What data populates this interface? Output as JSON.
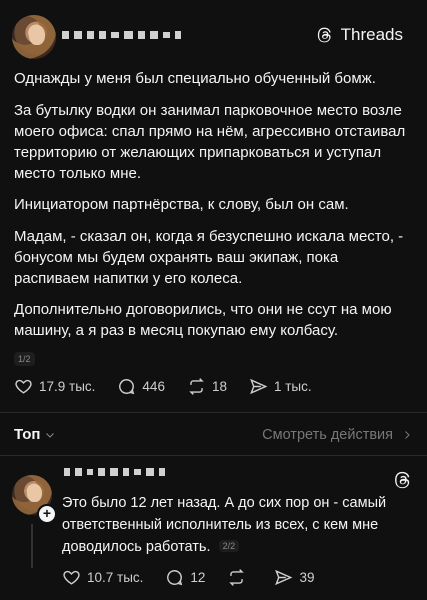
{
  "brand": {
    "name": "Threads"
  },
  "post": {
    "paragraphs": [
      "Однажды у меня был специально обученный бомж.",
      "За бутылку водки он занимал парковочное место возле моего офиса: спал прямо на нём, агрессивно отстаивал территорию от желающих припарковаться и уступал место только мне.",
      "Инициатором партнёрства, к слову, был он сам.",
      "Мадам, - сказал он, когда я безуспешно искала место, - бонусом мы будем охранять ваш экипаж, пока распиваем напитки у его колеса.",
      "Дополнительно договорились, что они не ссут на мою машину, а я раз в месяц покупаю ему колбасу."
    ],
    "pager": "1/2",
    "likes": "17.9 тыс.",
    "comments": "446",
    "reposts": "18",
    "shares": "1 тыс."
  },
  "sort": {
    "label": "Топ",
    "view_activity": "Смотреть действия"
  },
  "reply": {
    "text": "Это было 12 лет назад. А до сих пор он - самый ответственный исполнитель из всех, с кем мне доводилось работать.",
    "pager": "2/2",
    "likes": "10.7 тыс.",
    "comments": "12",
    "reposts": "",
    "shares": "39"
  }
}
